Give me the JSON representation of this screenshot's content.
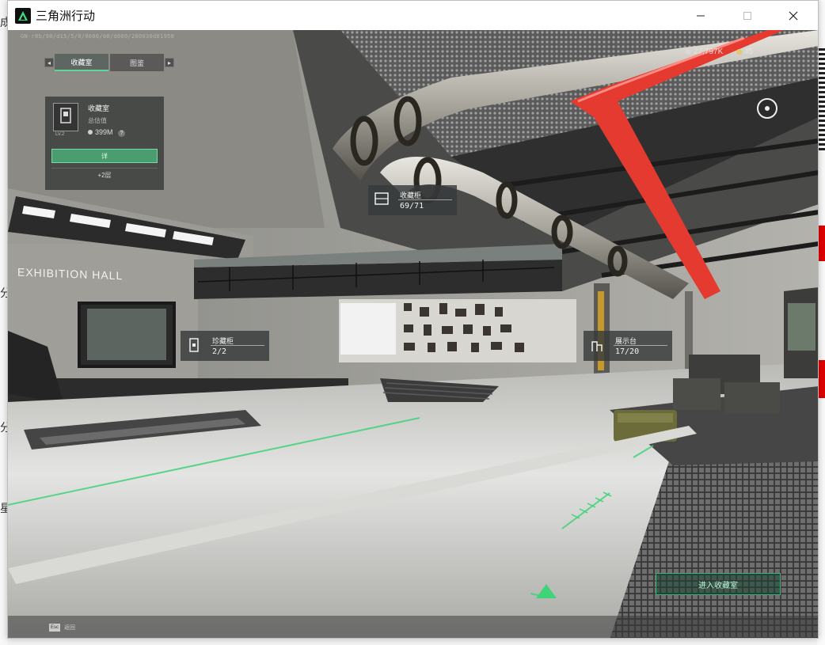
{
  "window": {
    "title": "三角洲行动"
  },
  "bg_page": {
    "fragments": [
      "成",
      "分",
      "分?",
      "星"
    ]
  },
  "hud": {
    "debug_text": "GN-r8b/90/d15/5/0/0000/00/d000/200030d01950",
    "tabs": [
      {
        "label": "收藏室",
        "active": true
      },
      {
        "label": "图鉴",
        "active": false
      }
    ],
    "currency": [
      {
        "value": "27,797K",
        "color": "#d9d9d9"
      },
      {
        "value": "45",
        "color": "#e8c86a"
      }
    ],
    "room_card": {
      "name": "收藏室",
      "sub": "总估值",
      "value": "399M",
      "level": "LV.2",
      "primary_button": "详",
      "secondary_button": "+2层"
    },
    "labels": [
      {
        "title": "收藏柜",
        "count": "69/71"
      },
      {
        "title": "珍藏柜",
        "count": "2/2"
      },
      {
        "title": "展示台",
        "count": "17/20"
      }
    ],
    "hall_sign": "EXHIBITION HALL",
    "enter_button": "进入收藏室",
    "esc_key": "Esc",
    "esc_label": "返回",
    "colors": {
      "accent": "#5fd59b",
      "pipe_red": "#e53a2f"
    }
  }
}
